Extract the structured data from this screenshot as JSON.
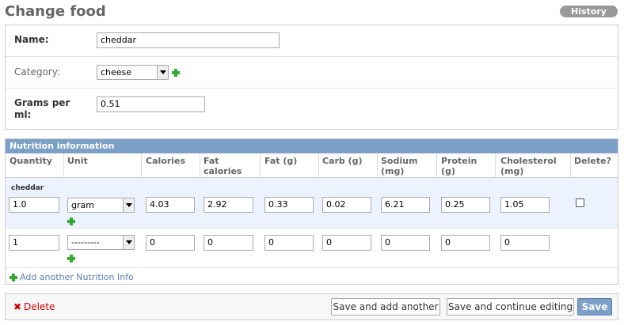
{
  "header": {
    "title": "Change food",
    "history_label": "History"
  },
  "fields": {
    "name": {
      "label": "Name:",
      "value": "cheddar"
    },
    "category": {
      "label": "Category:",
      "value": "cheese"
    },
    "grams_per_ml": {
      "label": "Grams per ml:",
      "value": "0.51"
    }
  },
  "inline": {
    "title": "Nutrition information",
    "columns": [
      "Quantity",
      "Unit",
      "Calories",
      "Fat calories",
      "Fat (g)",
      "Carb (g)",
      "Sodium (mg)",
      "Protein (g)",
      "Cholesterol (mg)",
      "Delete?"
    ],
    "original_label": "cheddar",
    "rows": [
      {
        "quantity": "1.0",
        "unit": "gram",
        "calories": "4.03",
        "fat_calories": "2.92",
        "fat_g": "0.33",
        "carb_g": "0.02",
        "sodium_mg": "6.21",
        "protein_g": "0.25",
        "cholesterol_mg": "1.05"
      },
      {
        "quantity": "1",
        "unit": "---------",
        "calories": "0",
        "fat_calories": "0",
        "fat_g": "0",
        "carb_g": "0",
        "sodium_mg": "0",
        "protein_g": "0",
        "cholesterol_mg": "0"
      }
    ],
    "add_another_label": "Add another Nutrition Info"
  },
  "submit": {
    "delete_label": "Delete",
    "save_add_label": "Save and add another",
    "save_continue_label": "Save and continue editing",
    "save_label": "Save"
  },
  "colors": {
    "accent": "#7ca0c7",
    "link": "#5b80b2",
    "delete": "#cc0000",
    "add": "#33aa33"
  }
}
